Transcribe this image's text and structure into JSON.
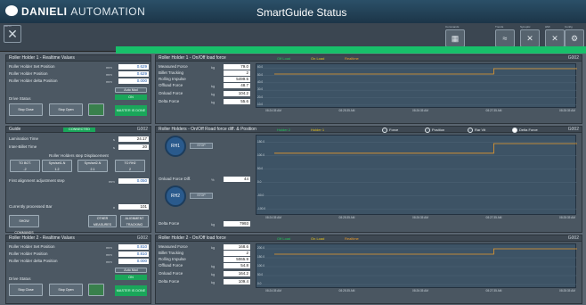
{
  "header": {
    "brand": "DANIELI",
    "brand2": "AUTOMATION",
    "title": "SmartGuide Status",
    "menu_label": "MENU"
  },
  "toolbar": [
    {
      "label": "Commands",
      "icon": "grid-icon",
      "glyph": "▦"
    },
    {
      "label": "Trends",
      "icon": "wave-icon",
      "glyph": "≈"
    },
    {
      "label": "Synoptic",
      "icon": "x-icon",
      "glyph": "✕"
    },
    {
      "label": "HMI",
      "icon": "cross-icon",
      "glyph": "✕"
    },
    {
      "label": "Config",
      "icon": "gear-icon",
      "glyph": "⚙"
    }
  ],
  "rh1": {
    "title": "Roller Holder 1 - Realtime Values",
    "rows": [
      {
        "label": "Roller Holder Set Position",
        "unit": "mm",
        "value": "0.629"
      },
      {
        "label": "Roller Holder Position",
        "unit": "mm",
        "value": "0.629"
      },
      {
        "label": "Roller Holder delta Position",
        "unit": "mm",
        "value": "0.000"
      }
    ],
    "auto": "Auto Mod",
    "on": "ON",
    "drive_status": "Drive Status",
    "stop": "Stop Close",
    "open": "Stop Open",
    "master": "MASTER IS DONE"
  },
  "guide": {
    "title": "Guide",
    "status": "CONNECTED",
    "right": "G002",
    "lam_time": {
      "label": "Lamination Time",
      "unit": "s",
      "value": "24.17"
    },
    "inter_billet": {
      "label": "Inter-Billet Time",
      "unit": "s",
      "value": "20"
    },
    "step_caption": "Roller Holders step Displacement",
    "steps": [
      "TO BOT.",
      "Sym/set1-N",
      "Sym/set2-N",
      "TO RH2"
    ],
    "step_sub": [
      "-2",
      "1.2",
      "2.1",
      "2"
    ],
    "first_align": {
      "label": "First alignment adjustment step",
      "unit": "mm",
      "value": "0.050"
    },
    "processed": {
      "label": "Currently processed Bar",
      "unit": "n",
      "value": "101"
    },
    "show_cmd": "SHOW COMMANDS",
    "other": "OTHER MEASURES",
    "align": "ALIGNMENT TRACKING"
  },
  "rh2": {
    "title": "Roller Holder 2 - Realtime Values",
    "right": "G002",
    "rows": [
      {
        "label": "Roller Holder Set Position",
        "unit": "mm",
        "value": "0.810"
      },
      {
        "label": "Roller Holder Position",
        "unit": "mm",
        "value": "0.810"
      },
      {
        "label": "Roller Holder delta Position",
        "unit": "mm",
        "value": "0.000"
      }
    ],
    "auto": "Auto Mod",
    "on": "ON",
    "drive_status": "Drive Status",
    "stop": "Stop Close",
    "open": "Stop Open",
    "master": "MASTER IS DONE"
  },
  "c1": {
    "title": "Roller Holder 1 - On/Off load force",
    "right": "G002",
    "legend": [
      "Off Load",
      "On Load",
      "Realtime"
    ],
    "rows": [
      {
        "label": "Measured Force",
        "unit": "kg",
        "value": "79.0"
      },
      {
        "label": "Billet Tracking",
        "unit": "",
        "value": "2"
      },
      {
        "label": "Rolling Impulse",
        "unit": "",
        "value": "5499.5"
      },
      {
        "label": "Offload Force",
        "unit": "kg",
        "value": "48.7"
      },
      {
        "label": "Onload Force",
        "unit": "kg",
        "value": "104.2"
      },
      {
        "label": "Delta Force",
        "unit": "kg",
        "value": "55.6"
      }
    ],
    "yt": [
      "60.0",
      "50.0",
      "40.0",
      "30.0",
      "20.0",
      "10.0"
    ],
    "xt": [
      "08:24:35 AM",
      "08:25:35 AM",
      "08:26:35 AM",
      "08:27:35 AM",
      "08:28:35 AM"
    ],
    "xd": "03/04/2019"
  },
  "c2": {
    "title": "Roller Holders - On/Off Road force diff. & Position",
    "right": "G002",
    "legend": [
      "Holder 2",
      "Holder 1"
    ],
    "radios": [
      "Force",
      "Position",
      "Rar Vit",
      "Delta Force"
    ],
    "rh1": "RH1",
    "rh2": "RH2",
    "stop": "STOP",
    "onload_diff": {
      "label": "Onload Force Diff.",
      "unit": "%",
      "value": "44"
    },
    "delta": {
      "label": "Delta Force",
      "unit": "kg",
      "value": "7993"
    },
    "yt": [
      "150.0",
      "100.0",
      "50.0",
      "0.0",
      "-50.0",
      "-100.0"
    ],
    "xt": [
      "08:24:35 AM",
      "08:25:35 AM",
      "08:26:35 AM",
      "08:27:35 AM",
      "08:28:35 AM"
    ]
  },
  "c3": {
    "title": "Roller Holder 2 - On/Off load force",
    "right": "G002",
    "legend": [
      "Off Load",
      "On Load",
      "Realtime"
    ],
    "rows": [
      {
        "label": "Measured Force",
        "unit": "kg",
        "value": "168.6"
      },
      {
        "label": "Billet Tracking",
        "unit": "",
        "value": "2"
      },
      {
        "label": "Rolling Impulse",
        "unit": "",
        "value": "5065.9"
      },
      {
        "label": "Offload Force",
        "unit": "kg",
        "value": "54.8"
      },
      {
        "label": "Onload Force",
        "unit": "kg",
        "value": "164.2"
      },
      {
        "label": "Delta Force",
        "unit": "kg",
        "value": "109.4"
      }
    ],
    "yt": [
      "200.0",
      "150.0",
      "100.0",
      "50.0",
      "0.0"
    ],
    "xt": [
      "08:24:35 AM",
      "08:25:35 AM",
      "08:26:35 AM",
      "08:27:35 AM",
      "08:28:35 AM"
    ]
  },
  "colors": {
    "offload": "#22c45a",
    "onload": "#e6c21e",
    "realtime": "#e89a2c"
  }
}
